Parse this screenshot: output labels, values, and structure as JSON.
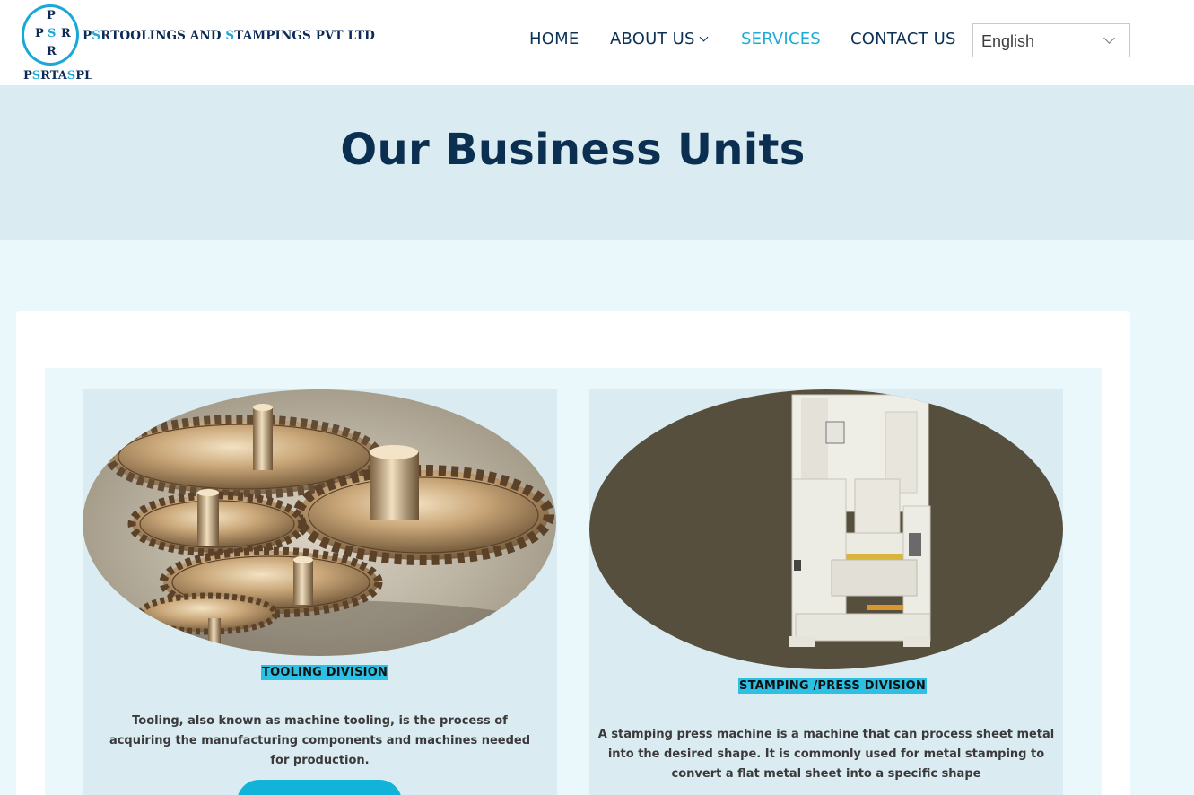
{
  "header": {
    "logo": {
      "letters": {
        "top": "P",
        "left": "P",
        "center": "S",
        "right": "R",
        "bottom": "R"
      },
      "company_name_parts": [
        "P",
        "S",
        "RTOOLINGS AND ",
        "S",
        "TAMPINGS PVT LTD"
      ],
      "abbr_parts": [
        "P",
        "S",
        "RTA",
        "S",
        "PL"
      ]
    },
    "nav": {
      "home": "HOME",
      "about": "ABOUT US",
      "services": "SERVICES",
      "contact": "CONTACT US"
    },
    "language_select": {
      "value": "English"
    }
  },
  "hero": {
    "title": "Our Business Units"
  },
  "units": [
    {
      "label": "TOOLING DIVISION",
      "description": "Tooling, also known as machine tooling, is the process of acquiring the manufacturing components and machines needed for production.",
      "image": "brass-gears-image"
    },
    {
      "label": "STAMPING /PRESS DIVISION",
      "description": "A stamping press machine is a machine that can process sheet metal into the desired shape. It is commonly used for metal stamping to convert a flat metal sheet into a specific shape",
      "image": "stamping-press-machine-image"
    }
  ],
  "colors": {
    "accent": "#1aaed6",
    "navy": "#0b3155",
    "hero_bg": "#dbebf2",
    "page_bg": "#eaf8fc",
    "label_highlight": "#2bc0e4"
  }
}
